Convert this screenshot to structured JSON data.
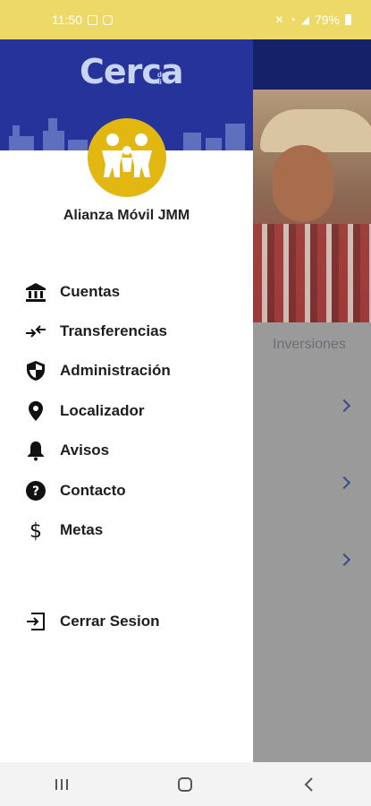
{
  "status_bar": {
    "time": "11:50",
    "battery": "79%"
  },
  "drawer": {
    "brand": "Cerca",
    "brand_sub_top": "de",
    "brand_sub_bottom": "ti",
    "org_name": "Alianza Móvil JMM",
    "menu": [
      {
        "label": "Cuentas",
        "icon": "bank-icon"
      },
      {
        "label": "Transferencias",
        "icon": "transfer-arrows-icon"
      },
      {
        "label": "Administración",
        "icon": "shield-icon"
      },
      {
        "label": "Localizador",
        "icon": "location-pin-icon"
      },
      {
        "label": "Avisos",
        "icon": "bell-icon"
      },
      {
        "label": "Contacto",
        "icon": "help-circle-icon"
      },
      {
        "label": "Metas",
        "icon": "dollar-icon"
      }
    ],
    "logout": {
      "label": "Cerrar Sesion",
      "icon": "logout-icon"
    }
  },
  "background": {
    "tab_label": "Inversiones"
  },
  "colors": {
    "status_bar": "#ecd968",
    "header": "#25339a",
    "avatar": "#e3b712"
  }
}
